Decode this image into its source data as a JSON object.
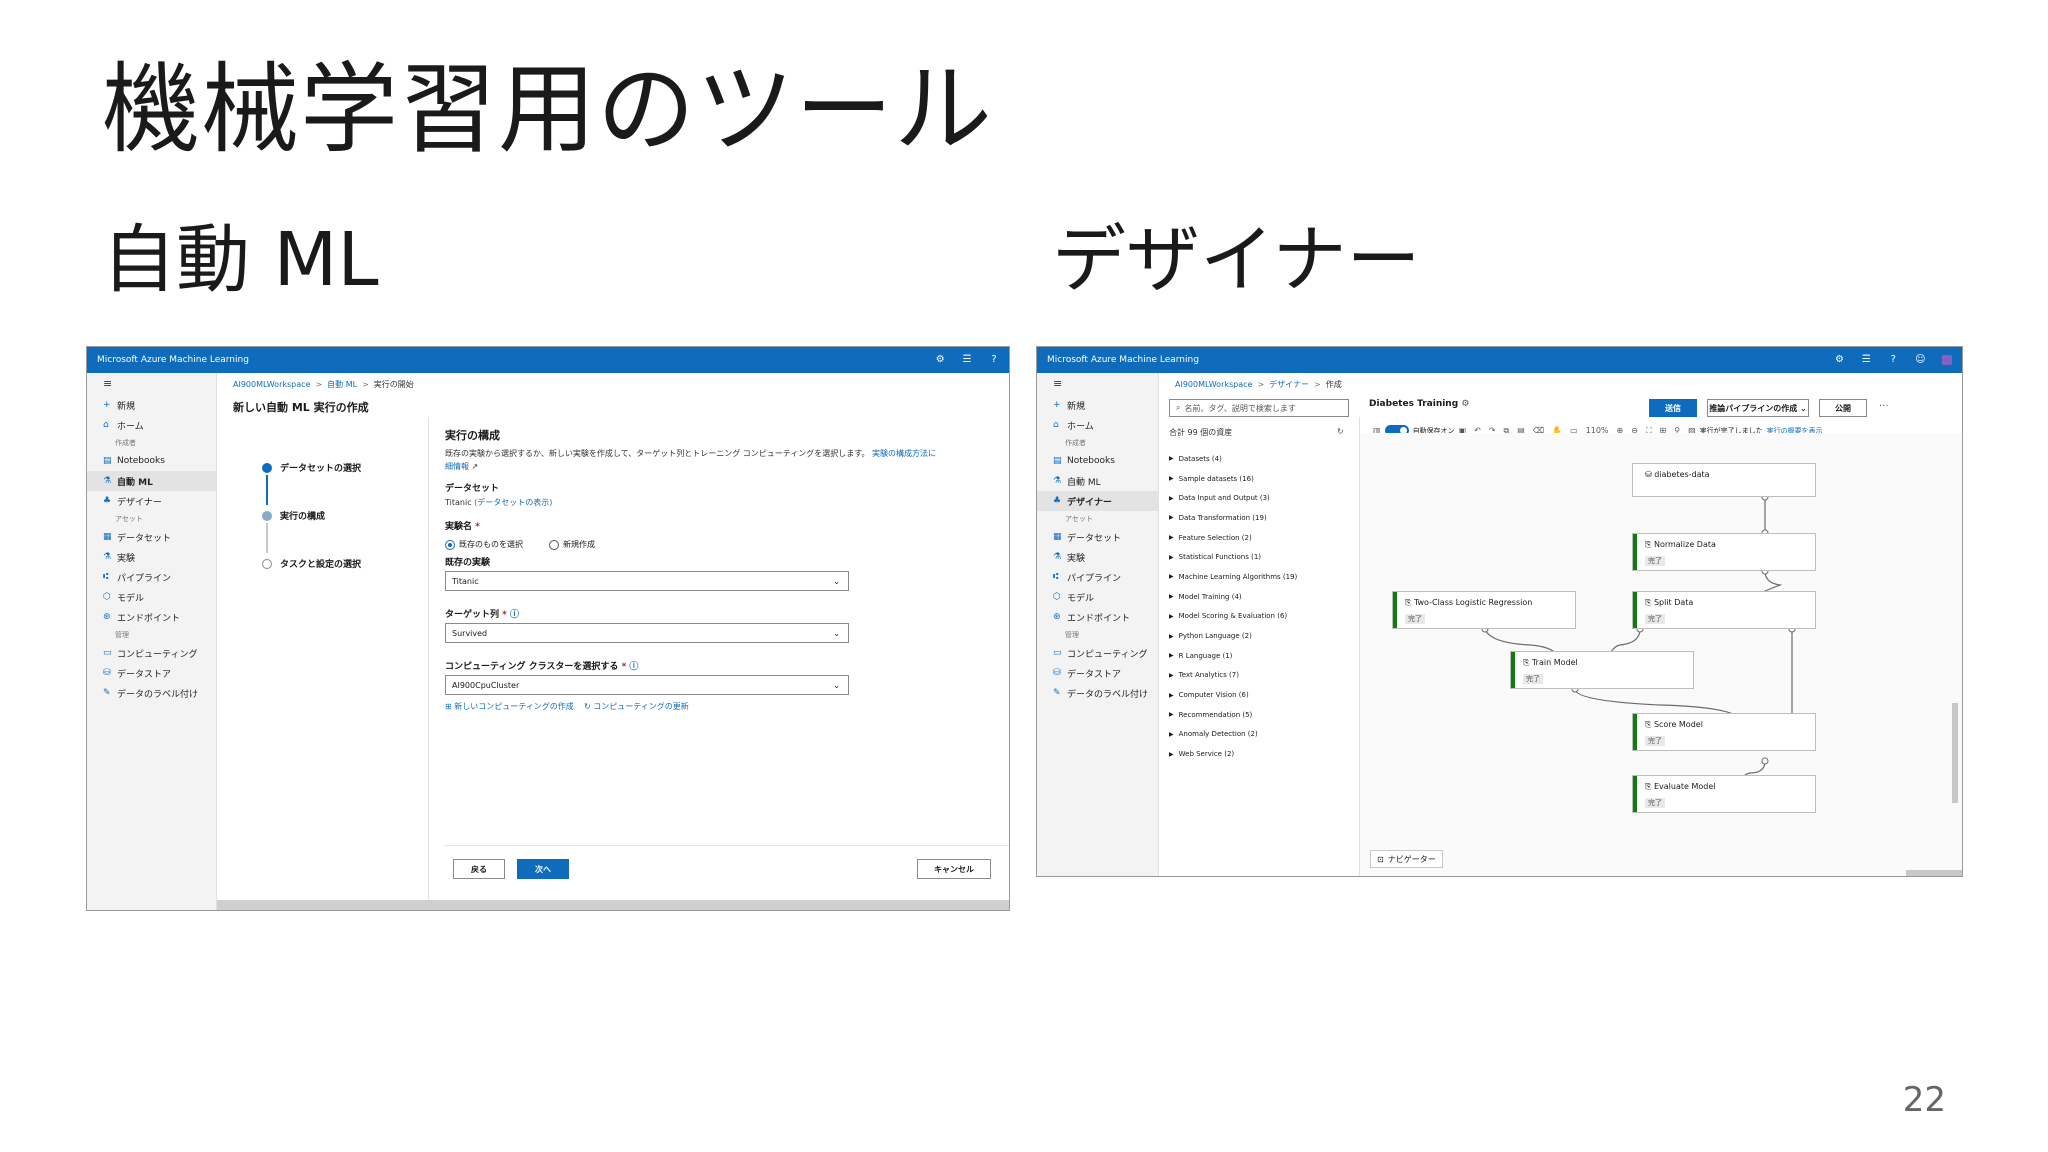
{
  "slide": {
    "title": "機械学習用のツール",
    "left_heading": "自動 ML",
    "right_heading": "デザイナー",
    "page_number": "22"
  },
  "automl": {
    "app_title": "Microsoft Azure Machine Learning",
    "nav": {
      "items": [
        {
          "label": "新規"
        },
        {
          "label": "ホーム"
        },
        {
          "section": "作成者"
        },
        {
          "label": "Notebooks"
        },
        {
          "label": "自動 ML",
          "active": true
        },
        {
          "label": "デザイナー"
        },
        {
          "section": "アセット"
        },
        {
          "label": "データセット"
        },
        {
          "label": "実験"
        },
        {
          "label": "パイプライン"
        },
        {
          "label": "モデル"
        },
        {
          "label": "エンドポイント"
        },
        {
          "section": "管理"
        },
        {
          "label": "コンピューティング"
        },
        {
          "label": "データストア"
        },
        {
          "label": "データのラベル付け"
        }
      ]
    },
    "breadcrumb": [
      "AI900MLWorkspace",
      "自動 ML",
      "実行の開始"
    ],
    "page_heading": "新しい自動 ML 実行の作成",
    "steps": [
      "データセットの選択",
      "実行の構成",
      "タスクと設定の選択"
    ],
    "form": {
      "heading": "実行の構成",
      "description": "既存の実験から選択するか、新しい実験を作成して、ターゲット列とトレーニング コンピューティングを選択します。",
      "description_link": "実験の構成方法に",
      "description_link2": "細情報",
      "dataset_label": "データセット",
      "dataset_value": "Titanic",
      "dataset_link": "(データセットの表示)",
      "experiment_label": "実験名",
      "radio_existing": "既存のものを選択",
      "radio_new": "新規作成",
      "existing_label": "既存の実験",
      "existing_value": "Titanic",
      "target_label": "ターゲット列",
      "target_value": "Survived",
      "cluster_label": "コンピューティング クラスターを選択する",
      "cluster_value": "AI900CpuCluster",
      "link_new_compute": "新しいコンピューティングの作成",
      "link_refresh_compute": "コンピューティングの更新"
    },
    "buttons": {
      "back": "戻る",
      "next": "次へ",
      "cancel": "キャンセル"
    }
  },
  "designer": {
    "app_title": "Microsoft Azure Machine Learning",
    "nav": {
      "items": [
        {
          "label": "新規"
        },
        {
          "label": "ホーム"
        },
        {
          "section": "作成者"
        },
        {
          "label": "Notebooks"
        },
        {
          "label": "自動 ML"
        },
        {
          "label": "デザイナー",
          "active": true
        },
        {
          "section": "アセット"
        },
        {
          "label": "データセット"
        },
        {
          "label": "実験"
        },
        {
          "label": "パイプライン"
        },
        {
          "label": "モデル"
        },
        {
          "label": "エンドポイント"
        },
        {
          "section": "管理"
        },
        {
          "label": "コンピューティング"
        },
        {
          "label": "データストア"
        },
        {
          "label": "データのラベル付け"
        }
      ]
    },
    "breadcrumb": [
      "AI900MLWorkspace",
      "デザイナー",
      "作成"
    ],
    "search_placeholder": "名前、タグ、説明で検索します",
    "asset_count": "合計 99 個の資産",
    "assets": [
      "Datasets (4)",
      "Sample datasets (16)",
      "Data Input and Output (3)",
      "Data Transformation (19)",
      "Feature Selection (2)",
      "Statistical Functions (1)",
      "Machine Learning Algorithms (19)",
      "Model Training (4)",
      "Model Scoring & Evaluation (6)",
      "Python Language (2)",
      "R Language (1)",
      "Text Analytics (7)",
      "Computer Vision (6)",
      "Recommendation (5)",
      "Anomaly Detection (2)",
      "Web Service (2)"
    ],
    "pipeline_title": "Diabetes Training",
    "buttons": {
      "submit": "送信",
      "inference": "推論パイプラインの作成",
      "publish": "公開"
    },
    "toolbar": {
      "autosave": "自動保存オン",
      "zoom": "110%",
      "status": "実行が完了しました",
      "status_link": "実行の概要を表示"
    },
    "nodes": [
      {
        "name": "diabetes-data",
        "status": ""
      },
      {
        "name": "Normalize Data",
        "status": "完了"
      },
      {
        "name": "Two-Class Logistic Regression",
        "status": "完了"
      },
      {
        "name": "Split Data",
        "status": "完了"
      },
      {
        "name": "Train Model",
        "status": "完了"
      },
      {
        "name": "Score Model",
        "status": "完了"
      },
      {
        "name": "Evaluate Model",
        "status": "完了"
      }
    ],
    "navigator": "ナビゲーター",
    "status_color": "#107c10"
  }
}
